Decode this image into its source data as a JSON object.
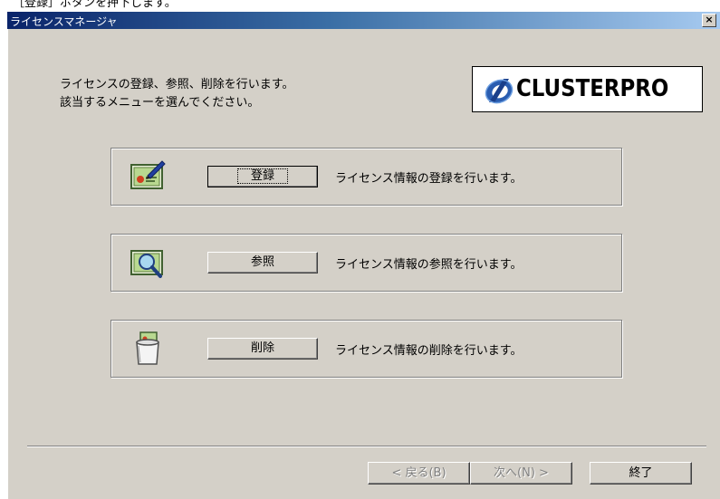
{
  "caption": "［登録］ボタンを押下します。",
  "window": {
    "title": "ライセンスマネージャ",
    "close_label": "×"
  },
  "intro": {
    "line1": "ライセンスの登録、参照、削除を行います。",
    "line2": "該当するメニューを選んでください。"
  },
  "logo": {
    "text": "CLUSTERPRO"
  },
  "panels": [
    {
      "button": "登録",
      "description": "ライセンス情報の登録を行います。",
      "icon": "register-license-icon"
    },
    {
      "button": "参照",
      "description": "ライセンス情報の参照を行います。",
      "icon": "view-license-icon"
    },
    {
      "button": "削除",
      "description": "ライセンス情報の削除を行います。",
      "icon": "delete-license-icon"
    }
  ],
  "footer": {
    "back": "< 戻る(B)",
    "next": "次へ(N) >",
    "finish": "終了"
  }
}
